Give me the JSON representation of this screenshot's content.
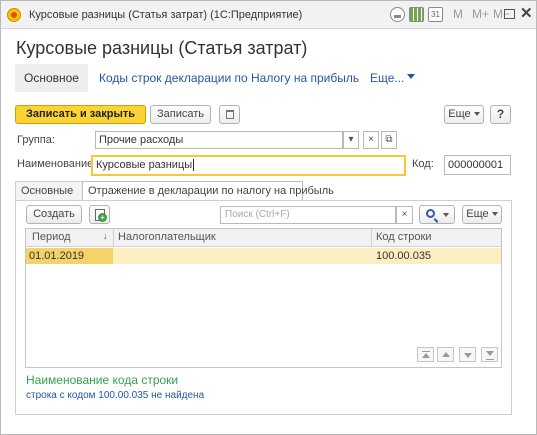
{
  "window": {
    "title": "Курсовые разницы (Статья затрат)  (1С:Предприятие)",
    "toolbar_m": "M",
    "toolbar_mplus": "M+",
    "toolbar_mminus": "M−",
    "close_glyph": "✕",
    "calendar_glyph": "31",
    "icons": [
      "app-logo-icon",
      "link-icon",
      "calculator-icon",
      "calendar-icon",
      "maximize-icon",
      "close-icon"
    ]
  },
  "page_title": "Курсовые разницы (Статья затрат)",
  "nav": {
    "main": "Основное",
    "link1": "Коды строк декларации по Налогу на прибыль",
    "more": "Еще..."
  },
  "command_bar": {
    "save_close": "Записать и закрыть",
    "save": "Записать",
    "more": "Еще",
    "help": "?"
  },
  "form": {
    "group_label": "Группа:",
    "group_value": "Прочие расходы",
    "dropdown_glyph": "▾",
    "clear_glyph": "×",
    "open_glyph": "⧉",
    "name_label": "Наименование:",
    "name_value": "Курсовые разницы",
    "code_label": "Код:",
    "code_value": "000000001"
  },
  "tabs": [
    {
      "label": "Основные",
      "active": false
    },
    {
      "label": "Отражение в декларации по налогу на прибыль",
      "active": true
    }
  ],
  "list_toolbar": {
    "create": "Создать",
    "search_placeholder": "Поиск (Ctrl+F)",
    "clear_glyph": "×",
    "more": "Еще"
  },
  "table": {
    "columns": [
      "Период",
      "Налогоплательщик",
      "Код строки"
    ],
    "sort_glyph": "↓",
    "rows": [
      {
        "period": "01.01.2019",
        "taxpayer": "",
        "code": "100.00.035",
        "selected": true
      }
    ]
  },
  "info": {
    "title": "Наименование кода строки",
    "text": "строка с кодом 100.00.035 не найдена"
  },
  "colors": {
    "primary_button": "#fbd332",
    "link": "#2456a6",
    "info_title": "#33a24b",
    "selected_row": "#fbeec0",
    "focus_border": "#f7c63b"
  }
}
